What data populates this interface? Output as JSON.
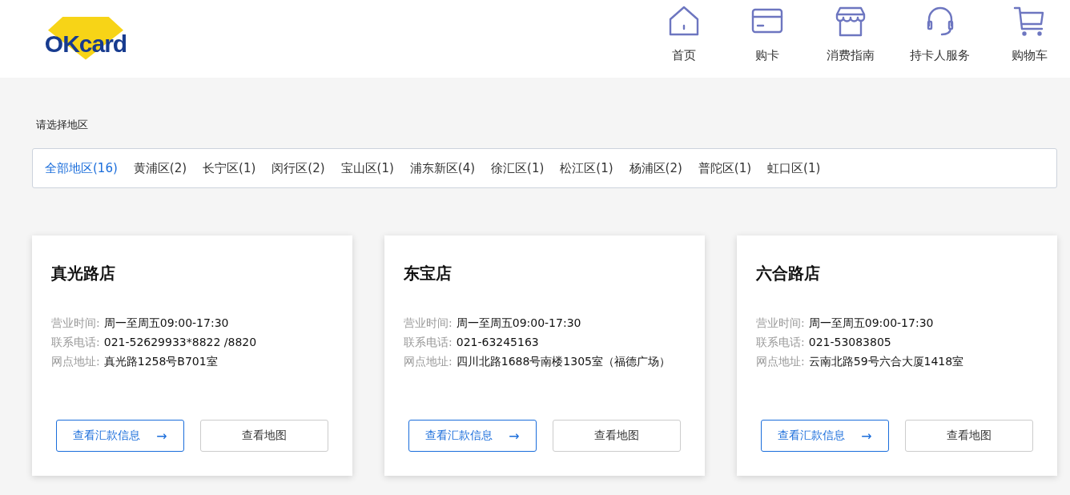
{
  "header": {
    "logo": "OKcard",
    "nav": [
      {
        "label": "首页",
        "kind": "home"
      },
      {
        "label": "购卡",
        "kind": "card"
      },
      {
        "label": "消费指南",
        "kind": "store"
      },
      {
        "label": "持卡人服务",
        "kind": "headset"
      },
      {
        "label": "购物车",
        "kind": "cart"
      }
    ]
  },
  "region_filter": {
    "title": "请选择地区",
    "regions": [
      {
        "label": "全部地区(16)",
        "selected": true
      },
      {
        "label": "黄浦区(2)",
        "selected": false
      },
      {
        "label": "长宁区(1)",
        "selected": false
      },
      {
        "label": "闵行区(2)",
        "selected": false
      },
      {
        "label": "宝山区(1)",
        "selected": false
      },
      {
        "label": "浦东新区(4)",
        "selected": false
      },
      {
        "label": "徐汇区(1)",
        "selected": false
      },
      {
        "label": "松江区(1)",
        "selected": false
      },
      {
        "label": "杨浦区(2)",
        "selected": false
      },
      {
        "label": "普陀区(1)",
        "selected": false
      },
      {
        "label": "虹口区(1)",
        "selected": false
      }
    ]
  },
  "stores": [
    {
      "name": "真光路店",
      "fields": [
        {
          "label": "营业时间:",
          "value": "周一至周五09:00-17:30"
        },
        {
          "label": "联系电话:",
          "value": "021-52629933*8822 /8820"
        },
        {
          "label": "网点地址:",
          "value": "真光路1258号B701室"
        }
      ],
      "primary_button": "查看汇款信息",
      "arrow": "→",
      "secondary_button": "查看地图"
    },
    {
      "name": "东宝店",
      "fields": [
        {
          "label": "营业时间:",
          "value": "周一至周五09:00-17:30"
        },
        {
          "label": "联系电话:",
          "value": "021-63245163"
        },
        {
          "label": "网点地址:",
          "value": "四川北路1688号南楼1305室（福德广场）"
        }
      ],
      "primary_button": "查看汇款信息",
      "arrow": "→",
      "secondary_button": "查看地图"
    },
    {
      "name": "六合路店",
      "fields": [
        {
          "label": "营业时间:",
          "value": "周一至周五09:00-17:30"
        },
        {
          "label": "联系电话:",
          "value": "021-53083805"
        },
        {
          "label": "网点地址:",
          "value": "云南北路59号六合大厦1418室"
        }
      ],
      "primary_button": "查看汇款信息",
      "arrow": "→",
      "secondary_button": "查看地图"
    }
  ]
}
